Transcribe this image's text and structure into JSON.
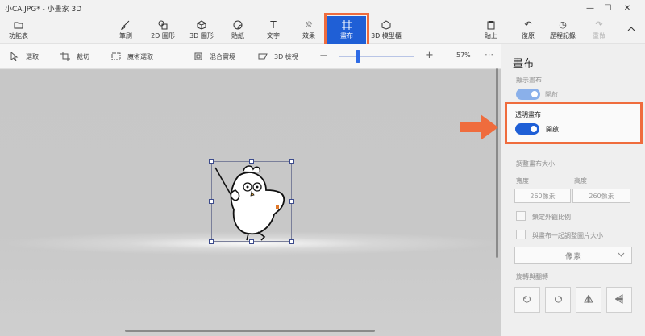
{
  "window": {
    "title": "小CA.JPG* - 小畫家 3D"
  },
  "toolbar": {
    "menu": "功能表",
    "brushes": "筆刷",
    "shapes2d": "2D 圖形",
    "shapes3d": "3D 圖形",
    "stickers": "貼紙",
    "text": "文字",
    "effects": "效果",
    "canvas": "畫布",
    "library": "3D 模型櫃",
    "paste": "貼上",
    "undo": "復原",
    "history": "歷程記錄",
    "redo": "重做"
  },
  "subbar": {
    "select": "選取",
    "crop": "裁切",
    "magic_select": "魔術選取",
    "mixed_reality": "混合實境",
    "view3d": "3D 檢視",
    "zoom_level": "57%",
    "zoom_fraction": 0.25
  },
  "panel": {
    "title": "畫布",
    "show_canvas_label": "顯示畫布",
    "show_canvas_state": "開啟",
    "transparent_label": "透明畫布",
    "transparent_state": "開啟",
    "resize_label": "調整畫布大小",
    "width_label": "寬度",
    "height_label": "高度",
    "width_value": "260像素",
    "height_value": "260像素",
    "lock_ratio": "鎖定外觀比例",
    "resize_image": "與畫布一起調整圖片大小",
    "unit": "像素",
    "rotate_label": "旋轉與翻轉"
  },
  "colors": {
    "accent": "#1f5fd6",
    "highlight": "#ef6c3d"
  }
}
